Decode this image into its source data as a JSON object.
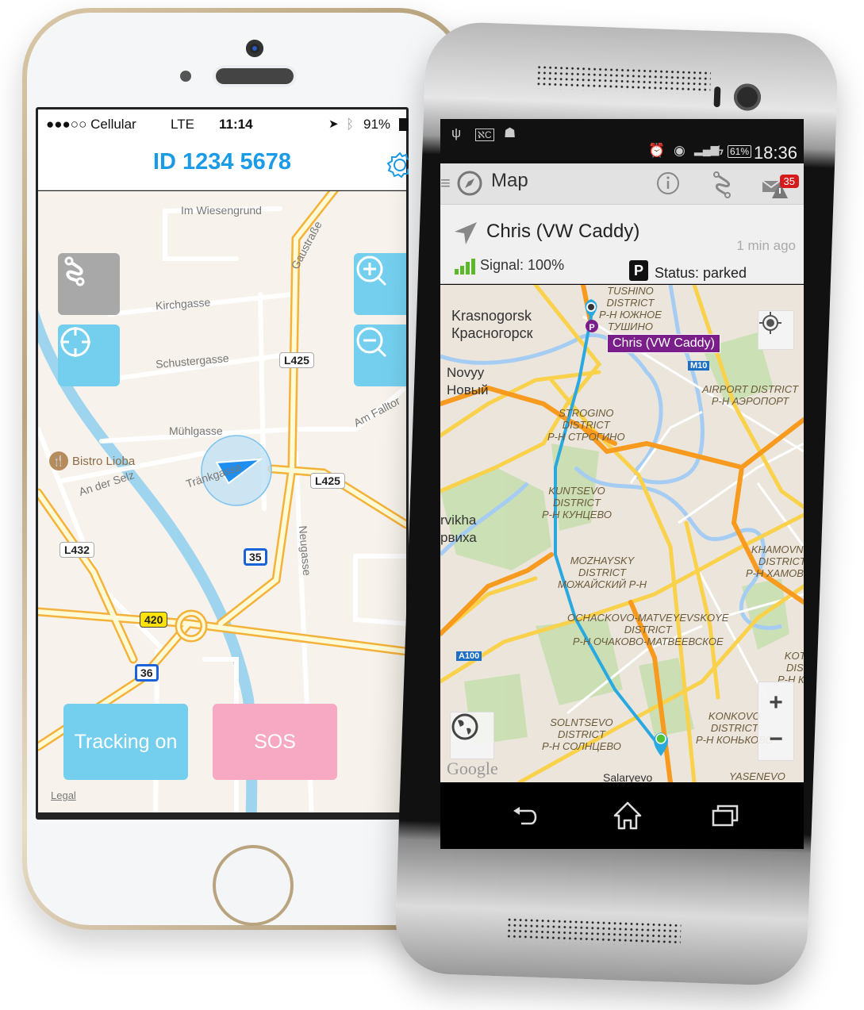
{
  "iphone": {
    "status_bar": {
      "carrier": "●●●○○ Cellular",
      "network": "LTE",
      "time": "11:14",
      "battery": "91%",
      "icons": [
        "location-arrow-icon",
        "bluetooth-icon",
        "battery-icon"
      ]
    },
    "header": {
      "title": "ID  1234 5678",
      "settings_icon": "gear-icon"
    },
    "map": {
      "streets": [
        "Im Wiesengrund",
        "Gaustraße",
        "Kirchgasse",
        "Schustergasse",
        "Mühlgasse",
        "Am Falltor",
        "Tränkgasse",
        "An der Selz",
        "Neugasse"
      ],
      "poi": "Bistro Lioba",
      "road_shields": [
        "L425",
        "L425",
        "L432",
        "35",
        "420",
        "36"
      ],
      "legal": "Legal"
    },
    "buttons": {
      "route": "route-icon",
      "locate": "crosshair-icon",
      "zoom_in": "zoom-in-icon",
      "zoom_out": "zoom-out-icon",
      "tracking": "Tracking on",
      "sos": "SOS"
    },
    "colors": {
      "accent": "#1a9be8",
      "tracking_button": "#74cfee",
      "sos_button": "#f7a9c4",
      "route_button": "#a8a8a8"
    }
  },
  "android": {
    "status_bar": {
      "icons_left": [
        "usb-icon",
        "voicemail-icon",
        "android-icon"
      ],
      "icons_right": [
        "alarm-icon",
        "wifi-icon",
        "signal-icon",
        "charging-icon"
      ],
      "battery": "61%",
      "time": "18:36"
    },
    "action_bar": {
      "title": "Map",
      "menu_icon": "hamburger-icon",
      "app_icon": "compass-icon",
      "actions": [
        "info-icon",
        "route-icon",
        "alert-mail-icon"
      ],
      "notification_count": "35"
    },
    "vehicle": {
      "name": "Chris (VW Caddy)",
      "updated": "1 min ago",
      "signal": "Signal: 100%",
      "status": "Status: parked",
      "status_badge": "P"
    },
    "map": {
      "callout": "Chris (VW Caddy)",
      "cities": [
        {
          "en": "Krasnogorsk",
          "ru": "Красногорск"
        },
        {
          "en": "Novyy",
          "ru": "Новый"
        },
        {
          "en": "rvikha",
          "ru": "рвиха"
        }
      ],
      "districts": [
        [
          "TUSHINO",
          "DISTRICT",
          "Р-Н ЮЖНОЕ",
          "ТУШИНО"
        ],
        [
          "AIRPORT DISTRICT",
          "Р-Н АЭРОПОРТ"
        ],
        [
          "STROGINO",
          "DISTRICT",
          "Р-Н СТРОГИНО"
        ],
        [
          "KUNTSEVO",
          "DISTRICT",
          "Р-Н КУНЦЕВО"
        ],
        [
          "KHAMOVNIK",
          "DISTRICT",
          "Р-Н ХАМОВНИ"
        ],
        [
          "MOZHAYSKY",
          "DISTRICT",
          "МОЖАЙСКИЙ Р-Н"
        ],
        [
          "OCHACKOVO-MATVEYEVSKOYE",
          "DISTRICT",
          "Р-Н ОЧАКОВО-МАТВЕЕВСКОЕ"
        ],
        [
          "KOTL",
          "DIST",
          "Р-Н КОТ"
        ],
        [
          "SOLNTSEVO",
          "DISTRICT",
          "Р-Н СОЛНЦЕВО"
        ],
        [
          "KONKOVO",
          "DISTRICT",
          "Р-Н КОНЬКОВО"
        ],
        [
          "YASENEVO"
        ]
      ],
      "places": [
        "Salaryevo"
      ],
      "route_shields": [
        "M10",
        "A100"
      ],
      "attribution": "Google",
      "zoom_in": "+",
      "zoom_out": "−"
    },
    "nav_bar": [
      "back-icon",
      "home-icon",
      "recents-icon"
    ],
    "colors": {
      "callout": "#7a1f8a",
      "route": "#29a9e0",
      "badge": "#d51b1b",
      "signal": "#5cb82a"
    }
  }
}
